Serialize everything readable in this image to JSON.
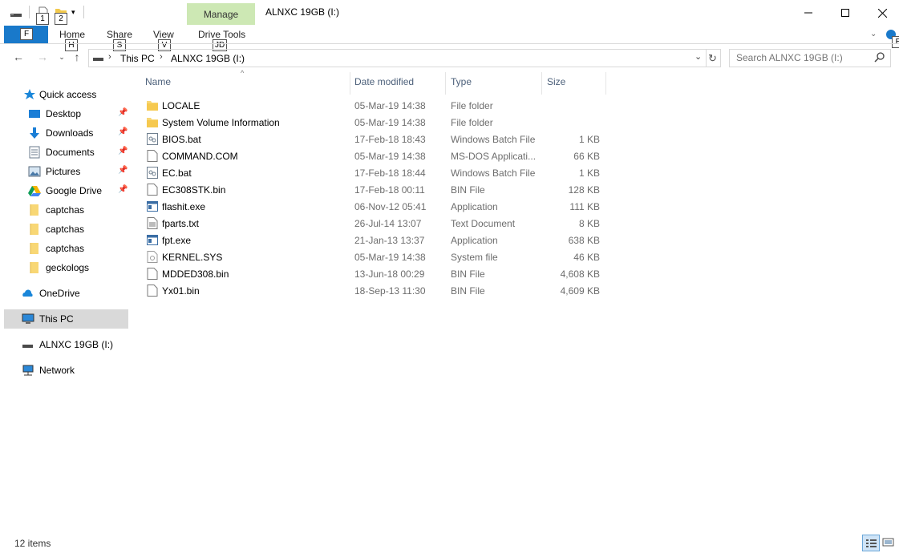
{
  "window": {
    "title": "ALNXC 19GB (I:)",
    "manage_tab": "Manage",
    "controls": [
      "minimize",
      "maximize",
      "close"
    ]
  },
  "quick_access_toolbar": {
    "keytips": [
      "1",
      "2"
    ]
  },
  "ribbon": {
    "file_tab": {
      "keytip": "F"
    },
    "tabs": [
      {
        "label": "Home",
        "keytip": "H"
      },
      {
        "label": "Share",
        "keytip": "S"
      },
      {
        "label": "View",
        "keytip": "V"
      },
      {
        "label": "Drive Tools",
        "keytip": "JD"
      }
    ],
    "help_keytip": "E"
  },
  "address": {
    "crumbs": [
      "This PC",
      "ALNXC 19GB (I:)"
    ]
  },
  "search": {
    "placeholder": "Search ALNXC 19GB (I:)"
  },
  "sidebar": {
    "quick_access": "Quick access",
    "items": [
      {
        "label": "Desktop",
        "icon": "desktop-icon",
        "pinned": true
      },
      {
        "label": "Downloads",
        "icon": "downloads-icon",
        "pinned": true
      },
      {
        "label": "Documents",
        "icon": "documents-icon",
        "pinned": true
      },
      {
        "label": "Pictures",
        "icon": "pictures-icon",
        "pinned": true
      },
      {
        "label": "Google Drive",
        "icon": "google-drive-icon",
        "pinned": true
      },
      {
        "label": "captchas",
        "icon": "folder-icon",
        "pinned": false
      },
      {
        "label": "captchas",
        "icon": "folder-icon",
        "pinned": false
      },
      {
        "label": "captchas",
        "icon": "folder-icon",
        "pinned": false
      },
      {
        "label": "geckologs",
        "icon": "folder-icon",
        "pinned": false
      }
    ],
    "onedrive": "OneDrive",
    "this_pc": "This PC",
    "drive": "ALNXC 19GB (I:)",
    "network": "Network"
  },
  "columns": {
    "name": "Name",
    "date": "Date modified",
    "type": "Type",
    "size": "Size"
  },
  "files": [
    {
      "name": "LOCALE",
      "date": "05-Mar-19 14:38",
      "type": "File folder",
      "size": "",
      "icon": "folder-icon"
    },
    {
      "name": "System Volume Information",
      "date": "05-Mar-19 14:38",
      "type": "File folder",
      "size": "",
      "icon": "folder-icon"
    },
    {
      "name": "BIOS.bat",
      "date": "17-Feb-18 18:43",
      "type": "Windows Batch File",
      "size": "1 KB",
      "icon": "batch-file-icon"
    },
    {
      "name": "COMMAND.COM",
      "date": "05-Mar-19 14:38",
      "type": "MS-DOS Applicati...",
      "size": "66 KB",
      "icon": "blank-file-icon"
    },
    {
      "name": "EC.bat",
      "date": "17-Feb-18 18:44",
      "type": "Windows Batch File",
      "size": "1 KB",
      "icon": "batch-file-icon"
    },
    {
      "name": "EC308STK.bin",
      "date": "17-Feb-18 00:11",
      "type": "BIN File",
      "size": "128 KB",
      "icon": "blank-file-icon"
    },
    {
      "name": "flashit.exe",
      "date": "06-Nov-12 05:41",
      "type": "Application",
      "size": "111 KB",
      "icon": "application-icon"
    },
    {
      "name": "fparts.txt",
      "date": "26-Jul-14 13:07",
      "type": "Text Document",
      "size": "8 KB",
      "icon": "text-file-icon"
    },
    {
      "name": "fpt.exe",
      "date": "21-Jan-13 13:37",
      "type": "Application",
      "size": "638 KB",
      "icon": "application-icon"
    },
    {
      "name": "KERNEL.SYS",
      "date": "05-Mar-19 14:38",
      "type": "System file",
      "size": "46 KB",
      "icon": "system-file-icon"
    },
    {
      "name": "MDDED308.bin",
      "date": "13-Jun-18 00:29",
      "type": "BIN File",
      "size": "4,608 KB",
      "icon": "blank-file-icon"
    },
    {
      "name": "Yx01.bin",
      "date": "18-Sep-13 11:30",
      "type": "BIN File",
      "size": "4,609 KB",
      "icon": "blank-file-icon"
    }
  ],
  "status": {
    "count": "12 items"
  },
  "colors": {
    "file_tab": "#1979ca",
    "manage_tab": "#cde8b4",
    "selection": "#d9d9d9",
    "column_header": "#4c607a"
  }
}
